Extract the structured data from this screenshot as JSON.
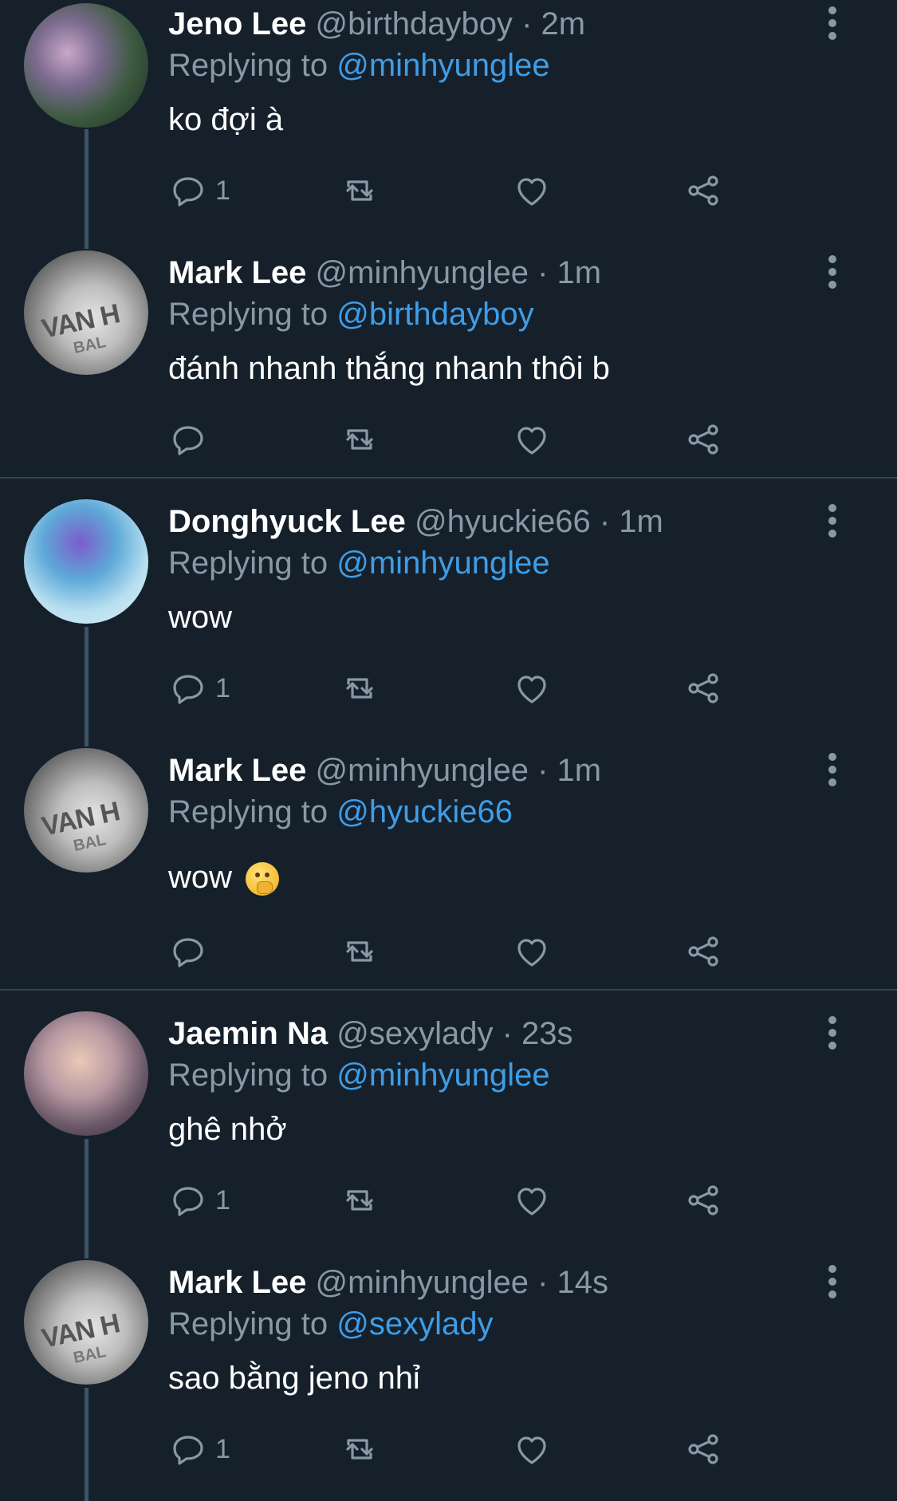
{
  "colors": {
    "background": "#15202b",
    "secondary_text": "#8899a6",
    "mention": "#3f9de6",
    "thread_line": "#3d5466",
    "divider": "#38444d"
  },
  "tweets": [
    {
      "name": "Jeno Lee",
      "handle": "@birthdayboy",
      "sep": "·",
      "time": "2m",
      "replying_label": "Replying to",
      "replying_to": "@minhyunglee",
      "text": "ko đợi à",
      "reply_count": "1",
      "avatar": "jeno-avatar"
    },
    {
      "name": "Mark Lee",
      "handle": "@minhyunglee",
      "sep": "·",
      "time": "1m",
      "replying_label": "Replying to",
      "replying_to": "@birthdayboy",
      "text": "đánh nhanh thắng nhanh thôi b",
      "reply_count": "",
      "avatar": "mark-avatar"
    },
    {
      "name": "Donghyuck Lee",
      "handle": "@hyuckie66",
      "sep": "·",
      "time": "1m",
      "replying_label": "Replying to",
      "replying_to": "@minhyunglee",
      "text": "wow",
      "reply_count": "1",
      "avatar": "donghyuck-avatar"
    },
    {
      "name": "Mark Lee",
      "handle": "@minhyunglee",
      "sep": "·",
      "time": "1m",
      "replying_label": "Replying to",
      "replying_to": "@hyuckie66",
      "text": "wow",
      "emoji": "shushing-face-emoji",
      "reply_count": "",
      "avatar": "mark-avatar"
    },
    {
      "name": "Jaemin Na",
      "handle": "@sexylady",
      "sep": "·",
      "time": "23s",
      "replying_label": "Replying to",
      "replying_to": "@minhyunglee",
      "text": "ghê nhở",
      "reply_count": "1",
      "avatar": "jaemin-avatar"
    },
    {
      "name": "Mark Lee",
      "handle": "@minhyunglee",
      "sep": "·",
      "time": "14s",
      "replying_label": "Replying to",
      "replying_to": "@sexylady",
      "text": "sao bằng jeno nhỉ",
      "reply_count": "1",
      "avatar": "mark-avatar"
    }
  ],
  "mark_avatar_print": "VAN H",
  "mark_avatar_print2": "BAL"
}
